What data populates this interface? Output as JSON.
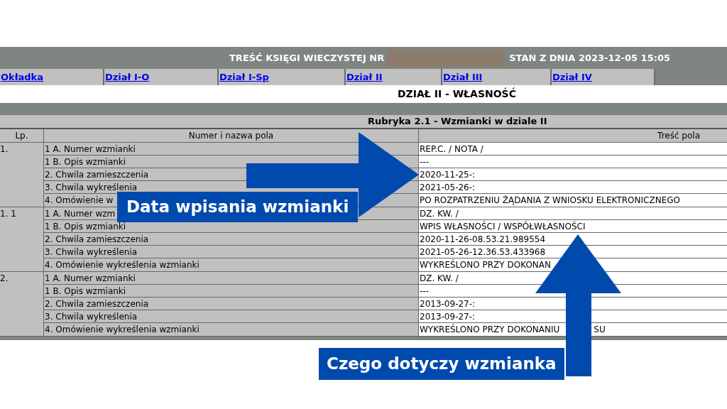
{
  "header": {
    "title": "TREŚĆ KSIĘGI WIECZYSTEJ NR",
    "status": "STAN Z DNIA 2023-12-05 15:05"
  },
  "tabs": [
    {
      "label": "Okładka"
    },
    {
      "label": "Dział I-O"
    },
    {
      "label": "Dział I-Sp"
    },
    {
      "label": "Dział II"
    },
    {
      "label": "Dział III"
    },
    {
      "label": "Dział IV"
    }
  ],
  "section_title": "DZIAŁ II - WŁASNOŚĆ",
  "table": {
    "caption": "Rubryka 2.1 - Wzmianki w dziale II",
    "columns": [
      "Lp.",
      "Numer i nazwa pola",
      "Treść pola"
    ],
    "entries": [
      {
        "lp": "1.",
        "fields": [
          {
            "name": "1 A. Numer wzmianki",
            "value": "REP.C. / NOTA /"
          },
          {
            "name": "1 B. Opis wzmianki",
            "value": "---"
          },
          {
            "name": "2. Chwila zamieszczenia",
            "value": "2020-11-25-:"
          },
          {
            "name": "3. Chwila wykreślenia",
            "value": "2021-05-26-:"
          },
          {
            "name": "4. Omówienie w",
            "value": "PO ROZPATRZENIU ŻĄDANIA Z WNIOSKU ELEKTRONICZNEGO"
          }
        ]
      },
      {
        "lp": "1. 1",
        "fields": [
          {
            "name": "1 A. Numer wzm",
            "value": "DZ. KW. /"
          },
          {
            "name": "1 B. Opis wzmianki",
            "value": "WPIS WŁASNOŚCI / WSPÓŁWŁASNOŚCI"
          },
          {
            "name": "2. Chwila zamieszczenia",
            "value": "2020-11-26-08.53.21.989554"
          },
          {
            "name": "3. Chwila wykreślenia",
            "value": "2021-05-26-12.36.53.433968"
          },
          {
            "name": "4. Omówienie wykreślenia wzmianki",
            "value": "WYKREŚLONO PRZY DOKONAN"
          }
        ]
      },
      {
        "lp": "2.",
        "fields": [
          {
            "name": "1 A. Numer wzmianki",
            "value": "DZ. KW. /"
          },
          {
            "name": "1 B. Opis wzmianki",
            "value": "---"
          },
          {
            "name": "2. Chwila zamieszczenia",
            "value": "2013-09-27-:"
          },
          {
            "name": "3. Chwila wykreślenia",
            "value": "2013-09-27-:"
          },
          {
            "name": "4. Omówienie wykreślenia wzmianki",
            "value": "WYKREŚLONO PRZY DOKONANIU",
            "tail": "SU"
          }
        ]
      }
    ]
  },
  "callouts": [
    {
      "kind": "right",
      "label": "Data wpisania wzmianki"
    },
    {
      "kind": "up",
      "label": "Czego dotyczy wzmianka"
    }
  ]
}
